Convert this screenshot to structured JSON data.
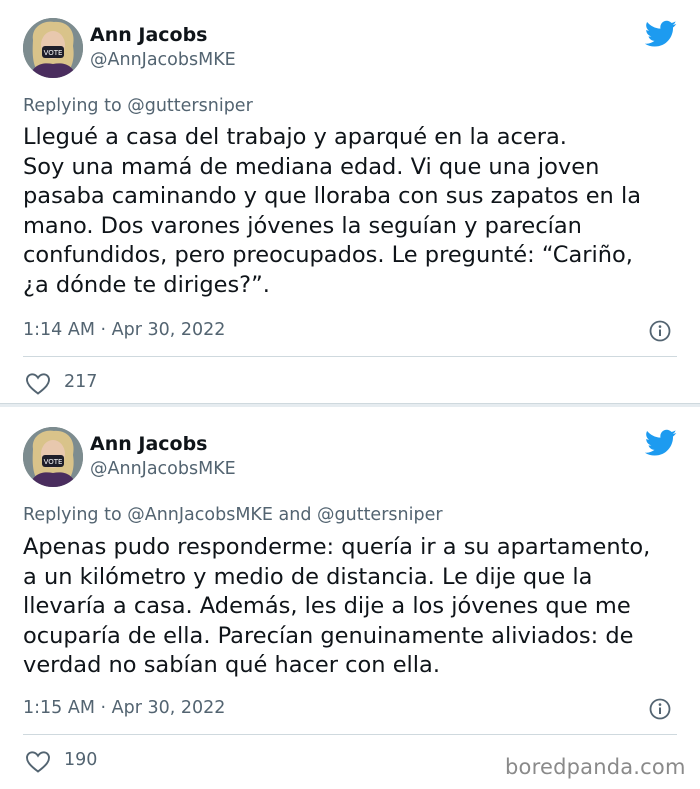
{
  "tweets": [
    {
      "author": {
        "name": "Ann Jacobs",
        "handle": "@AnnJacobsMKE"
      },
      "replying_prefix": "Replying to ",
      "replying_to": "@guttersniper",
      "text": "Llegué a casa del trabajo y aparqué en la acera.\nSoy una mamá de mediana edad. Vi que una joven\npasaba caminando y que lloraba con sus zapatos en la\nmano. Dos varones jóvenes la seguían y parecían\nconfundidos, pero preocupados. Le pregunté: “Cariño,\n¿a dónde te diriges?”.",
      "timestamp": "1:14 AM · Apr 30, 2022",
      "likes": "217"
    },
    {
      "author": {
        "name": "Ann Jacobs",
        "handle": "@AnnJacobsMKE"
      },
      "replying_prefix": "Replying to ",
      "replying_to": "@AnnJacobsMKE and @guttersniper",
      "text": "Apenas pudo responderme: quería ir a su apartamento,\na un kilómetro y medio de distancia. Le dije que la\nllevaría a casa. Además, les dije a los jóvenes que me\nocuparía de ella. Parecían genuinamente aliviados: de\nverdad no sabían qué hacer con ella.",
      "timestamp": "1:15 AM · Apr 30, 2022",
      "likes": "190"
    }
  ],
  "icons": {
    "brand": "twitter-bird-icon",
    "info": "info-icon",
    "like": "heart-icon"
  },
  "colors": {
    "twitter_blue": "#1d9bf0",
    "secondary_text": "#536471",
    "primary_text": "#0f1419"
  },
  "watermark": "boredpanda.com"
}
